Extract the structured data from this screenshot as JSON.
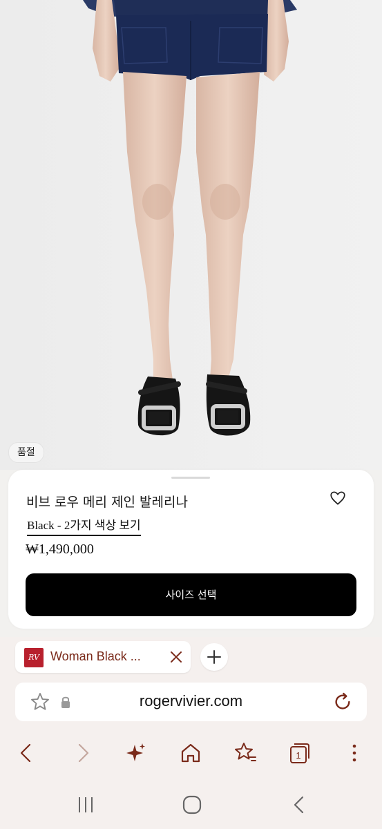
{
  "product": {
    "sold_out_badge": "품절",
    "title": "비브 로우 메리 제인 발레리나",
    "color_link": "Black - 2가지 색상 보기",
    "price": "₩1,490,000",
    "size_button": "사이즈 선택"
  },
  "browser": {
    "tab_title": "Woman Black ...",
    "favicon_text": "RV",
    "url": "rogervivier.com",
    "accent": "#7a2a1a"
  },
  "icons": {
    "wishlist": "heart-outline-icon",
    "tab_close": "close-icon",
    "new_tab": "plus-icon",
    "bookmark": "star-outline-icon",
    "secure": "lock-icon",
    "reload": "reload-icon",
    "back": "chevron-left-icon",
    "forward": "chevron-right-icon",
    "ai": "sparkle-icon",
    "home": "home-icon",
    "bookmarks": "star-list-icon",
    "tabs": "tabs-count-icon",
    "menu": "more-vertical-icon",
    "sys_recents": "recents-icon",
    "sys_home": "home-circle-icon",
    "sys_back": "system-back-icon"
  },
  "tab_count": "1"
}
